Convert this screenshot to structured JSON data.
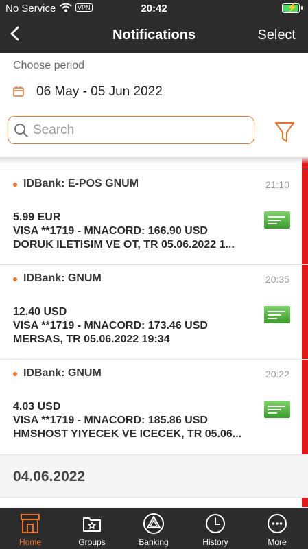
{
  "status_bar": {
    "carrier": "No Service",
    "vpn": "VPN",
    "time": "20:42"
  },
  "nav": {
    "title": "Notifications",
    "select_label": "Select"
  },
  "filter": {
    "period_label": "Choose period",
    "period_value": "06 May - 05 Jun 2022",
    "search_placeholder": "Search"
  },
  "notifications": [
    {
      "title": "IDBank: E-POS GNUM",
      "time": "21:10",
      "amount": "5.99 EUR",
      "detail": "VISA **1719 - MNACORD: 166.90 USD",
      "merchant": "DORUK ILETISIM VE OT, TR 05.06.2022 1..."
    },
    {
      "title": "IDBank: GNUM",
      "time": "20:35",
      "amount": "12.40 USD",
      "detail": "VISA **1719 - MNACORD: 173.46 USD",
      "merchant": "MERSAS, TR 05.06.2022 19:34"
    },
    {
      "title": "IDBank: GNUM",
      "time": "20:22",
      "amount": "4.03 USD",
      "detail": "VISA **1719 - MNACORD: 185.86 USD",
      "merchant": "HMSHOST YIYECEK VE ICECEK, TR 05.06..."
    }
  ],
  "date_header": "04.06.2022",
  "tabs": [
    {
      "label": "Home",
      "icon": "home-icon",
      "active": true
    },
    {
      "label": "Groups",
      "icon": "groups-icon",
      "active": false
    },
    {
      "label": "Banking",
      "icon": "banking-icon",
      "active": false
    },
    {
      "label": "History",
      "icon": "history-icon",
      "active": false
    },
    {
      "label": "More",
      "icon": "more-icon",
      "active": false
    }
  ],
  "colors": {
    "accent": "#e8742e",
    "header_bg": "#2c2c2c",
    "unread_bar": "#e01818",
    "card_icon": "#4caf3a"
  }
}
